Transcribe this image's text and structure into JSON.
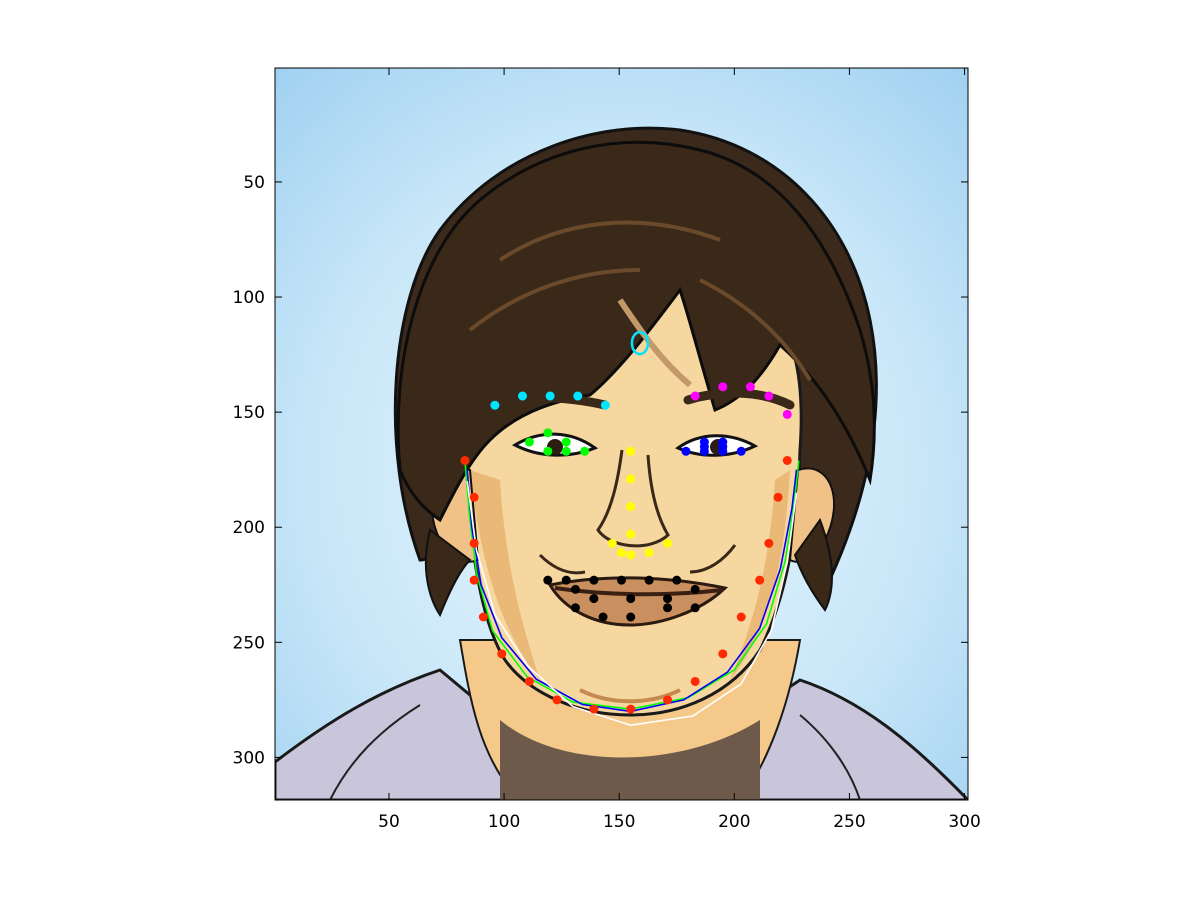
{
  "chart_data": {
    "type": "scatter",
    "title": "",
    "xlabel": "",
    "ylabel": "",
    "xlim": [
      0.5,
      301.5
    ],
    "ylim": [
      0.5,
      318.5
    ],
    "y_axis_reversed": true,
    "grid": false,
    "legend": "none",
    "x_ticks": [
      50,
      100,
      150,
      200,
      250,
      300
    ],
    "y_ticks": [
      50,
      100,
      150,
      200,
      250,
      300
    ],
    "background": "cartoon face photograph",
    "series": [
      {
        "color": "#00e5ff",
        "marker": "dot",
        "points": [
          [
            96,
            147
          ],
          [
            108,
            143
          ],
          [
            120,
            143
          ],
          [
            132,
            143
          ],
          [
            144,
            147
          ]
        ]
      },
      {
        "color": "#ff00ff",
        "marker": "dot",
        "points": [
          [
            183,
            143
          ],
          [
            195,
            139
          ],
          [
            207,
            139
          ],
          [
            215,
            143
          ],
          [
            223,
            151
          ]
        ]
      },
      {
        "color": "#00ff00",
        "marker": "dot",
        "points": [
          [
            111,
            163
          ],
          [
            119,
            159
          ],
          [
            127,
            163
          ],
          [
            135,
            167
          ],
          [
            127,
            167
          ],
          [
            119,
            167
          ]
        ]
      },
      {
        "color": "#0000ff",
        "marker": "dot",
        "points": [
          [
            179,
            167
          ],
          [
            187,
            163
          ],
          [
            195,
            163
          ],
          [
            203,
            167
          ],
          [
            195,
            167
          ],
          [
            187,
            167
          ],
          [
            195,
            165
          ],
          [
            187,
            165
          ]
        ]
      },
      {
        "color": "#ffff00",
        "marker": "dot",
        "points": [
          [
            155,
            167
          ],
          [
            155,
            179
          ],
          [
            155,
            191
          ],
          [
            155,
            203
          ],
          [
            147,
            207
          ],
          [
            151,
            211
          ],
          [
            155,
            212
          ],
          [
            163,
            211
          ],
          [
            171,
            207
          ]
        ]
      },
      {
        "color": "#000000",
        "marker": "dot",
        "points": [
          [
            119,
            223
          ],
          [
            127,
            223
          ],
          [
            139,
            223
          ],
          [
            151,
            223
          ],
          [
            163,
            223
          ],
          [
            175,
            223
          ],
          [
            131,
            227
          ],
          [
            139,
            231
          ],
          [
            155,
            231
          ],
          [
            171,
            231
          ],
          [
            183,
            227
          ],
          [
            131,
            235
          ],
          [
            143,
            239
          ],
          [
            155,
            239
          ],
          [
            171,
            235
          ],
          [
            183,
            235
          ]
        ]
      },
      {
        "color": "#ff2a00",
        "marker": "dot",
        "points": [
          [
            83,
            171
          ],
          [
            87,
            187
          ],
          [
            87,
            207
          ],
          [
            87,
            223
          ],
          [
            91,
            239
          ],
          [
            99,
            255
          ],
          [
            111,
            267
          ],
          [
            123,
            275
          ],
          [
            139,
            279
          ],
          [
            155,
            279
          ],
          [
            171,
            275
          ],
          [
            183,
            267
          ],
          [
            195,
            255
          ],
          [
            203,
            239
          ],
          [
            211,
            223
          ],
          [
            215,
            207
          ],
          [
            219,
            187
          ],
          [
            223,
            171
          ]
        ]
      },
      {
        "color": "#00e5ff",
        "marker": "ellipse",
        "points": [
          [
            159,
            120
          ]
        ]
      }
    ],
    "curves": [
      {
        "color": "#00ff00",
        "points": [
          [
            83,
            171
          ],
          [
            85,
            195
          ],
          [
            88,
            220
          ],
          [
            95,
            245
          ],
          [
            110,
            265
          ],
          [
            130,
            276
          ],
          [
            155,
            279
          ],
          [
            180,
            274
          ],
          [
            200,
            262
          ],
          [
            214,
            242
          ],
          [
            222,
            215
          ],
          [
            226,
            190
          ],
          [
            228,
            171
          ]
        ]
      },
      {
        "color": "#0000ff",
        "points": [
          [
            84,
            175
          ],
          [
            86,
            200
          ],
          [
            90,
            225
          ],
          [
            99,
            248
          ],
          [
            114,
            266
          ],
          [
            134,
            277
          ],
          [
            155,
            280
          ],
          [
            178,
            275
          ],
          [
            197,
            263
          ],
          [
            211,
            244
          ],
          [
            220,
            218
          ],
          [
            225,
            192
          ],
          [
            227,
            175
          ]
        ]
      },
      {
        "color": "#ffffff",
        "points": [
          [
            84,
            180
          ],
          [
            88,
            210
          ],
          [
            96,
            238
          ],
          [
            110,
            260
          ],
          [
            130,
            278
          ],
          [
            155,
            286
          ],
          [
            182,
            282
          ],
          [
            203,
            268
          ],
          [
            216,
            245
          ],
          [
            223,
            215
          ],
          [
            227,
            185
          ]
        ]
      }
    ]
  },
  "icons": {
    "background_image": "face-photo"
  }
}
